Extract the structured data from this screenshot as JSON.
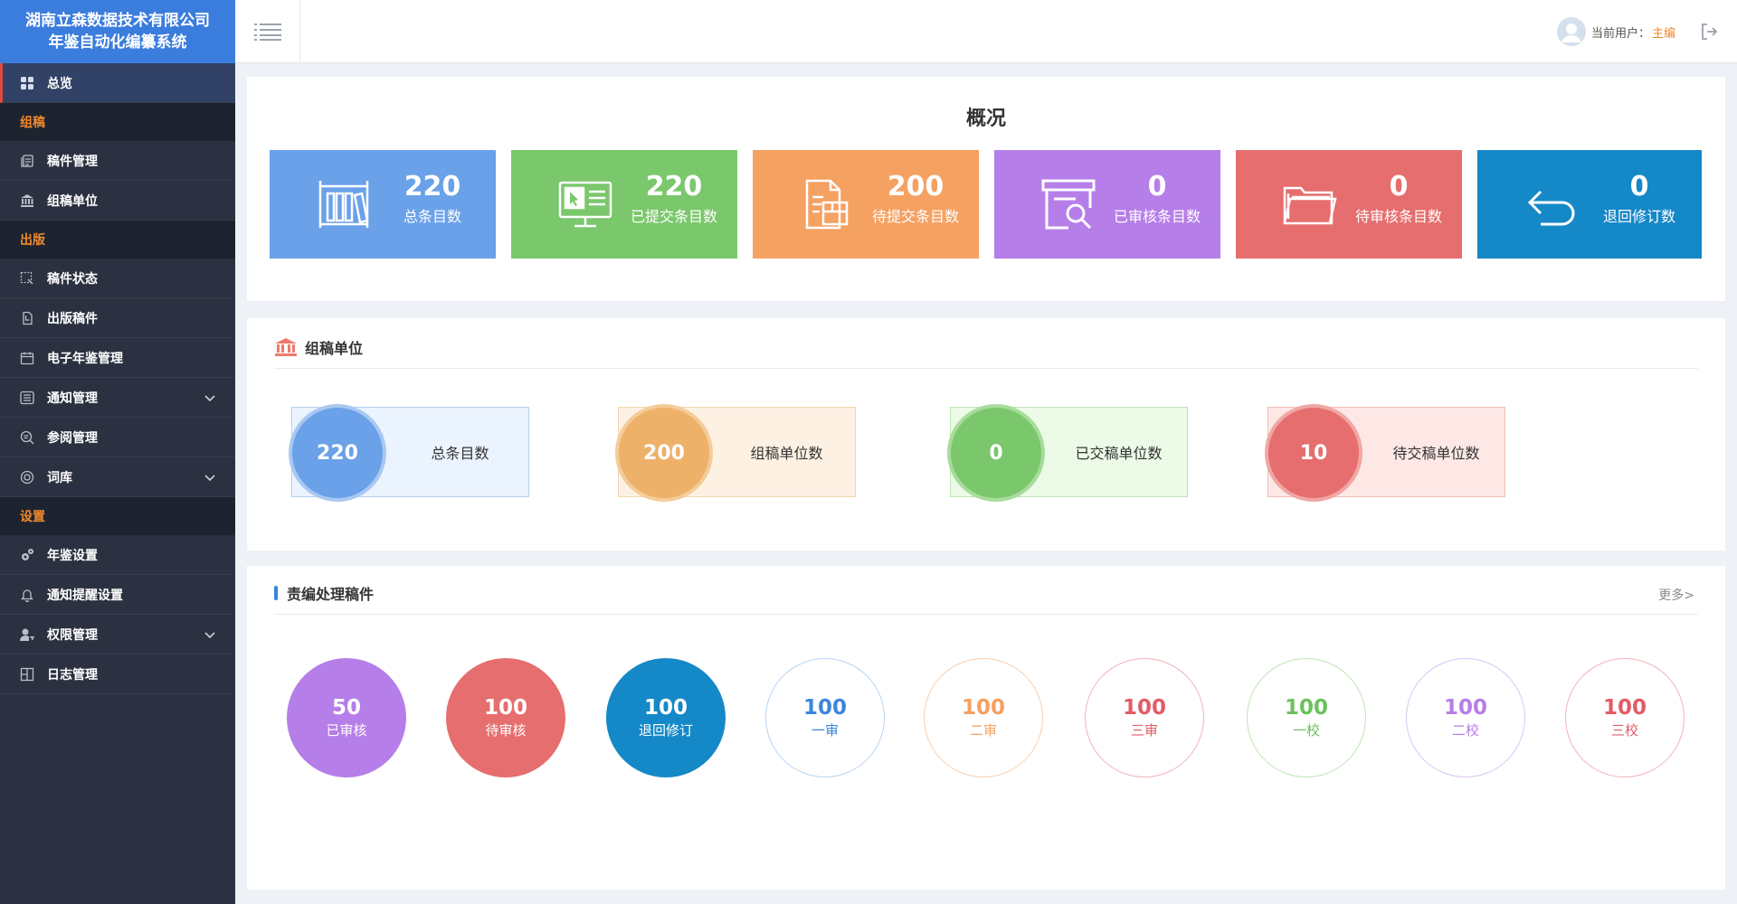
{
  "brand": {
    "line1": "湖南立森数据技术有限公司",
    "line2": "年鉴自动化编纂系统"
  },
  "sidebar": {
    "overview": "总览",
    "sections": [
      {
        "title": "组稿",
        "items": [
          {
            "label": "稿件管理",
            "icon": "document-stack-icon"
          },
          {
            "label": "组稿单位",
            "icon": "bank-icon"
          }
        ]
      },
      {
        "title": "出版",
        "items": [
          {
            "label": "稿件状态",
            "icon": "selection-cursor-icon"
          },
          {
            "label": "出版稿件",
            "icon": "file-copy-icon"
          },
          {
            "label": "电子年鉴管理",
            "icon": "calendar-icon"
          },
          {
            "label": "通知管理",
            "icon": "list-icon",
            "expandable": true
          },
          {
            "label": "参阅管理",
            "icon": "search-doc-icon"
          },
          {
            "label": "词库",
            "icon": "target-icon",
            "expandable": true
          }
        ]
      },
      {
        "title": "设置",
        "items": [
          {
            "label": "年鉴设置",
            "icon": "gears-icon"
          },
          {
            "label": "通知提醒设置",
            "icon": "bell-icon"
          },
          {
            "label": "权限管理",
            "icon": "user-key-icon",
            "expandable": true
          },
          {
            "label": "日志管理",
            "icon": "grid-icon"
          }
        ]
      }
    ]
  },
  "topbar": {
    "user_prefix": "当前用户：",
    "user_name": "主编"
  },
  "overview": {
    "title": "概况",
    "cards": [
      {
        "value": "220",
        "label": "总条目数",
        "color": "#6aa1e9",
        "icon": "bookshelf-icon"
      },
      {
        "value": "220",
        "label": "已提交条目数",
        "color": "#7bc76c",
        "icon": "monitor-submit-icon"
      },
      {
        "value": "200",
        "label": "待提交条目数",
        "color": "#f5a162",
        "icon": "document-box-icon"
      },
      {
        "value": "0",
        "label": "已审核条目数",
        "color": "#b67ee8",
        "icon": "screen-search-icon"
      },
      {
        "value": "0",
        "label": "待审核条目数",
        "color": "#e66e6e",
        "icon": "folder-icon"
      },
      {
        "value": "0",
        "label": "退回修订数",
        "color": "#1588c8",
        "icon": "return-arrow-icon"
      }
    ]
  },
  "units": {
    "title": "组稿单位",
    "items": [
      {
        "value": "220",
        "label": "总条目数",
        "color": "#6aa1e9",
        "bg": "#ebf3fe",
        "border": "#b6d1f2"
      },
      {
        "value": "200",
        "label": "组稿单位数",
        "color": "#edb16a",
        "bg": "#fdf1e3",
        "border": "#f2d6b0"
      },
      {
        "value": "0",
        "label": "已交稿单位数",
        "color": "#7bc76c",
        "bg": "#ecfbe7",
        "border": "#bfe3b5"
      },
      {
        "value": "10",
        "label": "待交稿单位数",
        "color": "#e66e6e",
        "bg": "#fde8e6",
        "border": "#f2bcb8"
      }
    ]
  },
  "editor": {
    "title": "责编处理稿件",
    "more": "更多>",
    "circles": [
      {
        "value": "50",
        "label": "已审核",
        "color": "#b67ee8",
        "filled": true
      },
      {
        "value": "100",
        "label": "待审核",
        "color": "#e66e6e",
        "filled": true
      },
      {
        "value": "100",
        "label": "退回修订",
        "color": "#1588c8",
        "filled": true
      },
      {
        "value": "100",
        "label": "一审",
        "color": "#3b86dc",
        "filled": false,
        "ring": "#b9d3f2"
      },
      {
        "value": "100",
        "label": "二审",
        "color": "#f5a162",
        "filled": false,
        "ring": "#f7cfb0"
      },
      {
        "value": "100",
        "label": "三审",
        "color": "#e25c66",
        "filled": false,
        "ring": "#f2b3b8"
      },
      {
        "value": "100",
        "label": "一校",
        "color": "#6cc15c",
        "filled": false,
        "ring": "#bfe5b6"
      },
      {
        "value": "100",
        "label": "二校",
        "color": "#b67ee8",
        "filled": false,
        "ring": "#dcc4f4"
      },
      {
        "value": "100",
        "label": "三校",
        "color": "#e25c66",
        "filled": false,
        "ring": "#f2b3b8"
      }
    ]
  }
}
